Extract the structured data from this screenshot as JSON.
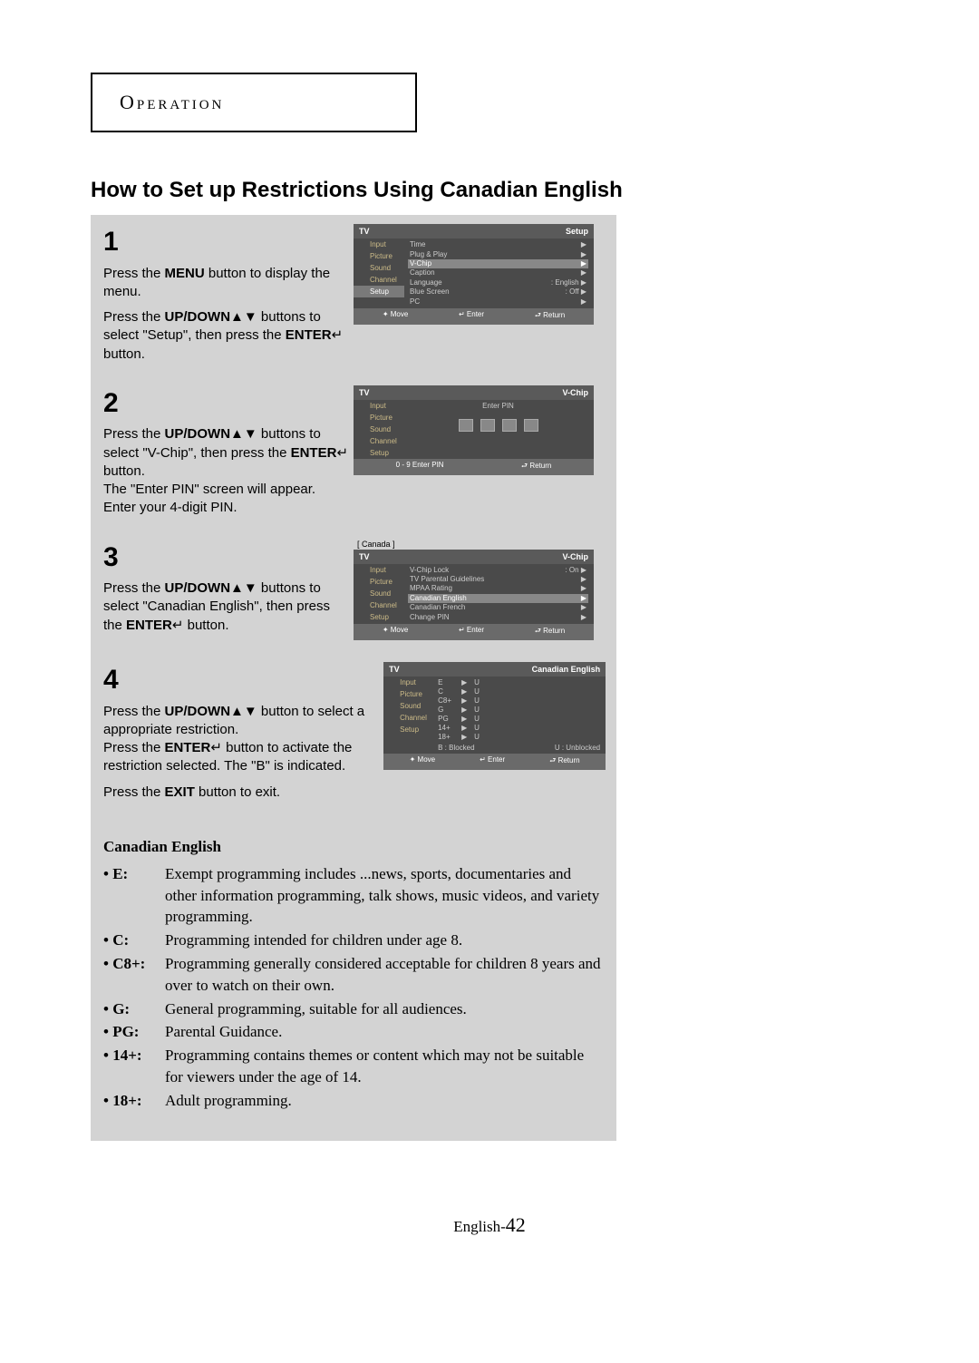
{
  "section_header": "Operation",
  "title": "How to Set up Restrictions Using Canadian English",
  "steps": {
    "s1": {
      "num": "1",
      "t1a": "Press the ",
      "t1b": "MENU",
      "t1c": " button to display the menu.",
      "t2a": "Press the ",
      "t2b": "UP/DOWN",
      "t2arrows": "▲▼",
      "t2c": " buttons to select \"Setup\", then press the ",
      "t2d": "ENTER",
      "t2icon": "↵",
      "t2e": " button.",
      "screen": {
        "title_l": "TV",
        "title_r": "Setup",
        "side": [
          "Input",
          "Picture",
          "Sound",
          "Channel",
          "Setup"
        ],
        "rows": [
          {
            "l": "Time",
            "r": "",
            "arr": "▶"
          },
          {
            "l": "Plug & Play",
            "r": "",
            "arr": "▶"
          },
          {
            "l": "V-Chip",
            "r": "",
            "arr": "▶",
            "sel": true
          },
          {
            "l": "Caption",
            "r": "",
            "arr": "▶"
          },
          {
            "l": "Language",
            "r": ": English",
            "arr": "▶"
          },
          {
            "l": "Blue Screen",
            "r": ": Off",
            "arr": "▶"
          },
          {
            "l": "PC",
            "r": "",
            "arr": "▶"
          }
        ],
        "footer": [
          "✦ Move",
          "↵ Enter",
          "⮐ Return"
        ]
      }
    },
    "s2": {
      "num": "2",
      "t1a": "Press the ",
      "t1b": "UP/DOWN",
      "t1arrows": "▲▼",
      "t1c": " buttons to select  \"V-Chip\", then press the ",
      "t1d": "ENTER",
      "t1icon": "↵",
      "t1e": " button.",
      "t2": "The \"Enter PIN\" screen will appear. Enter your 4-digit PIN.",
      "screen": {
        "title_l": "TV",
        "title_r": "V-Chip",
        "side": [
          "Input",
          "Picture",
          "Sound",
          "Channel",
          "Setup"
        ],
        "pin_label": "Enter PIN",
        "foot_l": "0 - 9 Enter PIN",
        "foot_r": "⮐ Return"
      }
    },
    "s3": {
      "num": "3",
      "t1a": "Press the ",
      "t1b": "UP/DOWN",
      "t1arrows": "▲▼",
      "t1c": " buttons to select \"Canadian English\", then press the ",
      "t1d": "ENTER",
      "t1icon": "↵",
      "t1e": " button.",
      "screen": {
        "pre": "[ Canada ]",
        "title_l": "TV",
        "title_r": "V-Chip",
        "side": [
          "Input",
          "Picture",
          "Sound",
          "Channel",
          "Setup"
        ],
        "rows": [
          {
            "l": "V-Chip Lock",
            "r": ": On",
            "arr": "▶"
          },
          {
            "l": "TV Parental Guidelines",
            "r": "",
            "arr": "▶"
          },
          {
            "l": "MPAA Rating",
            "r": "",
            "arr": "▶"
          },
          {
            "l": "Canadian English",
            "r": "",
            "arr": "▶",
            "sel": true
          },
          {
            "l": "Canadian French",
            "r": "",
            "arr": "▶"
          },
          {
            "l": "Change PIN",
            "r": "",
            "arr": "▶"
          }
        ],
        "footer": [
          "✦ Move",
          "↵ Enter",
          "⮐ Return"
        ]
      }
    },
    "s4": {
      "num": "4",
      "t1a": "Press the ",
      "t1b": "UP/DOWN",
      "t1arrows": "▲▼",
      "t1c": " button to select a appropriate restriction.",
      "t2a": "Press the ",
      "t2b": "ENTER",
      "t2icon": "↵",
      "t2c": " button to activate the restriction selected. The \"B\" is indicated.",
      "t3a": "Press the ",
      "t3b": "EXIT",
      "t3c": " button to exit.",
      "screen": {
        "title_l": "TV",
        "title_r": "Canadian English",
        "side": [
          "Input",
          "Picture",
          "Sound",
          "Channel",
          "Setup"
        ],
        "rat_rows": [
          {
            "l": "E",
            "a": "▶",
            "r": "U"
          },
          {
            "l": "C",
            "a": "▶",
            "r": "U"
          },
          {
            "l": "C8+",
            "a": "▶",
            "r": "U"
          },
          {
            "l": "G",
            "a": "▶",
            "r": "U"
          },
          {
            "l": "PG",
            "a": "▶",
            "r": "U"
          },
          {
            "l": "14+",
            "a": "▶",
            "r": "U"
          },
          {
            "l": "18+",
            "a": "▶",
            "r": "U"
          }
        ],
        "legend_l": "B : Blocked",
        "legend_r": "U : Unblocked",
        "footer": [
          "✦ Move",
          "↵ Enter",
          "⮐ Return"
        ]
      }
    }
  },
  "ratings": {
    "title": "Canadian English",
    "items": [
      {
        "label": "• E:",
        "desc": "Exempt programming includes ...news, sports, documentaries and other information programming, talk shows, music videos, and variety programming."
      },
      {
        "label": "• C:",
        "desc": "Programming intended for children under age 8."
      },
      {
        "label": "• C8+:",
        "desc": "Programming generally considered acceptable for children 8 years and over to watch on their own."
      },
      {
        "label": "• G:",
        "desc": "General programming, suitable for all audiences."
      },
      {
        "label": "• PG:",
        "desc": "Parental Guidance."
      },
      {
        "label": "• 14+:",
        "desc": "Programming contains themes or content which may not be suitable for viewers under the age of 14."
      },
      {
        "label": "• 18+:",
        "desc": "Adult programming."
      }
    ]
  },
  "page_prefix": "English-",
  "page_num": "42"
}
